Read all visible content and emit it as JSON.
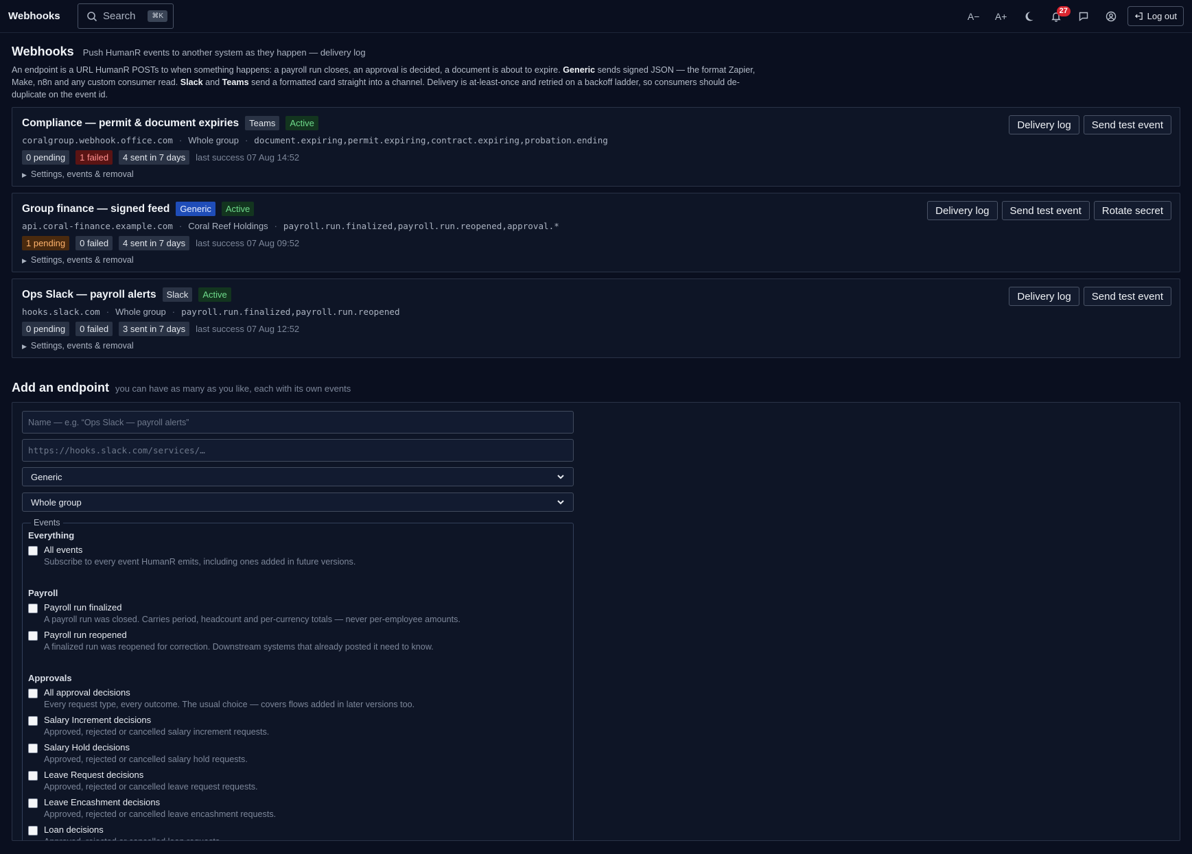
{
  "topbar": {
    "brand": "Webhooks",
    "search_label": "Search",
    "search_shortcut": "⌘K",
    "font_decrease": "A−",
    "font_increase": "A+",
    "notification_count": "27",
    "logout_label": "Log out"
  },
  "page": {
    "title": "Webhooks",
    "subtitle": "Push HumanR events to another system as they happen — delivery log"
  },
  "intro": {
    "part1": "An endpoint is a URL HumanR POSTs to when something happens: a payroll run closes, an approval is decided, a document is about to expire. ",
    "generic": "Generic",
    "part2": " sends signed JSON — the format Zapier, Make, n8n and any custom consumer read. ",
    "slack": "Slack",
    "and": " and ",
    "teams": "Teams",
    "part3": " send a formatted card straight into a channel. Delivery is at-least-once and retried on a backoff ladder, so consumers should de-duplicate on the event id."
  },
  "endpoints": [
    {
      "title": "Compliance — permit & document expiries",
      "type": "Teams",
      "status": "Active",
      "host": "coralgroup.webhook.office.com",
      "scope": "Whole group",
      "events": "document.expiring,permit.expiring,contract.expiring,probation.ending",
      "pending": "0 pending",
      "failed": "1 failed",
      "sent": "4 sent in 7 days",
      "last_success": "last success 07 Aug 14:52",
      "details": "Settings, events & removal",
      "actions": [
        "Delivery log",
        "Send test event"
      ]
    },
    {
      "title": "Group finance — signed feed",
      "type": "Generic",
      "status": "Active",
      "host": "api.coral-finance.example.com",
      "scope": "Coral Reef Holdings",
      "events": "payroll.run.finalized,payroll.run.reopened,approval.*",
      "pending": "1 pending",
      "failed": "0 failed",
      "sent": "4 sent in 7 days",
      "last_success": "last success 07 Aug 09:52",
      "details": "Settings, events & removal",
      "actions": [
        "Delivery log",
        "Send test event",
        "Rotate secret"
      ]
    },
    {
      "title": "Ops Slack — payroll alerts",
      "type": "Slack",
      "status": "Active",
      "host": "hooks.slack.com",
      "scope": "Whole group",
      "events": "payroll.run.finalized,payroll.run.reopened",
      "pending": "0 pending",
      "failed": "0 failed",
      "sent": "3 sent in 7 days",
      "last_success": "last success 07 Aug 12:52",
      "details": "Settings, events & removal",
      "actions": [
        "Delivery log",
        "Send test event"
      ]
    }
  ],
  "add": {
    "title": "Add an endpoint",
    "subtitle": "you can have as many as you like, each with its own events",
    "name_placeholder": "Name — e.g. “Ops Slack — payroll alerts”",
    "url_placeholder": "https://hooks.slack.com/services/…",
    "type_value": "Generic",
    "scope_value": "Whole group",
    "events_legend": "Events",
    "groups": [
      {
        "label": "Everything",
        "options": [
          {
            "label": "All events",
            "desc": "Subscribe to every event HumanR emits, including ones added in future versions."
          }
        ]
      },
      {
        "label": "Payroll",
        "options": [
          {
            "label": "Payroll run finalized",
            "desc": "A payroll run was closed. Carries period, headcount and per-currency totals — never per-employee amounts."
          },
          {
            "label": "Payroll run reopened",
            "desc": "A finalized run was reopened for correction. Downstream systems that already posted it need to know."
          }
        ]
      },
      {
        "label": "Approvals",
        "options": [
          {
            "label": "All approval decisions",
            "desc": "Every request type, every outcome. The usual choice — covers flows added in later versions too."
          },
          {
            "label": "Salary Increment decisions",
            "desc": "Approved, rejected or cancelled salary increment requests."
          },
          {
            "label": "Salary Hold decisions",
            "desc": "Approved, rejected or cancelled salary hold requests."
          },
          {
            "label": "Leave Request decisions",
            "desc": "Approved, rejected or cancelled leave request requests."
          },
          {
            "label": "Leave Encashment decisions",
            "desc": "Approved, rejected or cancelled leave encashment requests."
          },
          {
            "label": "Loan decisions",
            "desc": "Approved, rejected or cancelled loan requests."
          }
        ]
      }
    ]
  }
}
